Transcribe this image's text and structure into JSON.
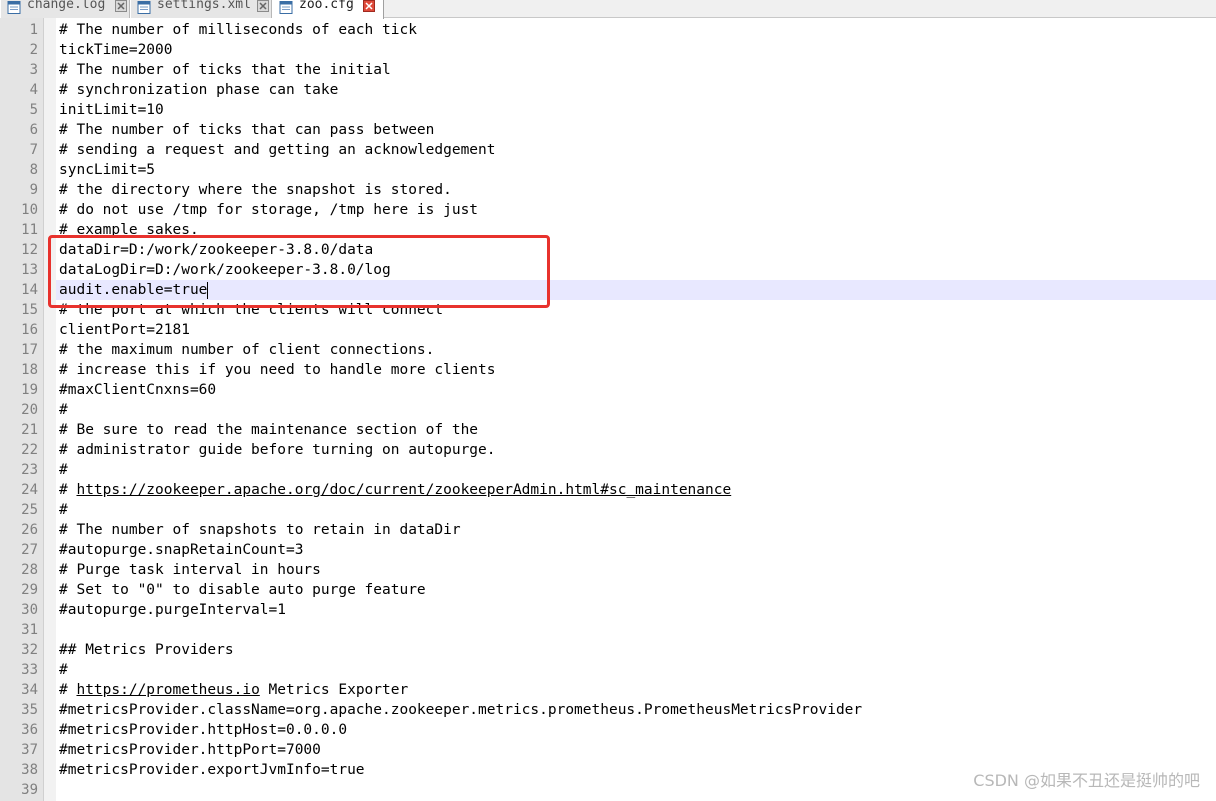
{
  "tabs": [
    {
      "label": "change.log",
      "active": false
    },
    {
      "label": "settings.xml",
      "active": false
    },
    {
      "label": "zoo.cfg",
      "active": true
    }
  ],
  "editor": {
    "current_line": 14,
    "lines": [
      {
        "n": "1",
        "text": "# The number of milliseconds of each tick"
      },
      {
        "n": "2",
        "text": "tickTime=2000"
      },
      {
        "n": "3",
        "text": "# The number of ticks that the initial"
      },
      {
        "n": "4",
        "text": "# synchronization phase can take"
      },
      {
        "n": "5",
        "text": "initLimit=10"
      },
      {
        "n": "6",
        "text": "# The number of ticks that can pass between"
      },
      {
        "n": "7",
        "text": "# sending a request and getting an acknowledgement"
      },
      {
        "n": "8",
        "text": "syncLimit=5"
      },
      {
        "n": "9",
        "text": "# the directory where the snapshot is stored."
      },
      {
        "n": "10",
        "text": "# do not use /tmp for storage, /tmp here is just"
      },
      {
        "n": "11",
        "text": "# example sakes."
      },
      {
        "n": "12",
        "text": "dataDir=D:/work/zookeeper-3.8.0/data"
      },
      {
        "n": "13",
        "text": "dataLogDir=D:/work/zookeeper-3.8.0/log"
      },
      {
        "n": "14",
        "text": "audit.enable=true"
      },
      {
        "n": "15",
        "text": "# the port at which the clients will connect"
      },
      {
        "n": "16",
        "text": "clientPort=2181"
      },
      {
        "n": "17",
        "text": "# the maximum number of client connections."
      },
      {
        "n": "18",
        "text": "# increase this if you need to handle more clients"
      },
      {
        "n": "19",
        "text": "#maxClientCnxns=60"
      },
      {
        "n": "20",
        "text": "#"
      },
      {
        "n": "21",
        "text": "# Be sure to read the maintenance section of the"
      },
      {
        "n": "22",
        "text": "# administrator guide before turning on autopurge."
      },
      {
        "n": "23",
        "text": "#"
      },
      {
        "n": "24",
        "pre": "# ",
        "link": "https://zookeeper.apache.org/doc/current/zookeeperAdmin.html#sc_maintenance",
        "post": ""
      },
      {
        "n": "25",
        "text": "#"
      },
      {
        "n": "26",
        "text": "# The number of snapshots to retain in dataDir"
      },
      {
        "n": "27",
        "text": "#autopurge.snapRetainCount=3"
      },
      {
        "n": "28",
        "text": "# Purge task interval in hours"
      },
      {
        "n": "29",
        "text": "# Set to \"0\" to disable auto purge feature"
      },
      {
        "n": "30",
        "text": "#autopurge.purgeInterval=1"
      },
      {
        "n": "31",
        "text": ""
      },
      {
        "n": "32",
        "text": "## Metrics Providers"
      },
      {
        "n": "33",
        "text": "#"
      },
      {
        "n": "34",
        "pre": "# ",
        "link": "https://prometheus.io",
        "post": " Metrics Exporter"
      },
      {
        "n": "35",
        "text": "#metricsProvider.className=org.apache.zookeeper.metrics.prometheus.PrometheusMetricsProvider"
      },
      {
        "n": "36",
        "text": "#metricsProvider.httpHost=0.0.0.0"
      },
      {
        "n": "37",
        "text": "#metricsProvider.httpPort=7000"
      },
      {
        "n": "38",
        "text": "#metricsProvider.exportJvmInfo=true"
      },
      {
        "n": "39",
        "text": ""
      }
    ]
  },
  "watermark": "CSDN @如果不丑还是挺帅的吧",
  "colors": {
    "highlight_box": "#e8322d",
    "current_line": "#e8e8ff",
    "line_number": "#808080",
    "gutter": "#e4e4e4"
  },
  "icons": {
    "tab_file": "notepad-file-icon",
    "tab_close": "close-x-icon"
  }
}
